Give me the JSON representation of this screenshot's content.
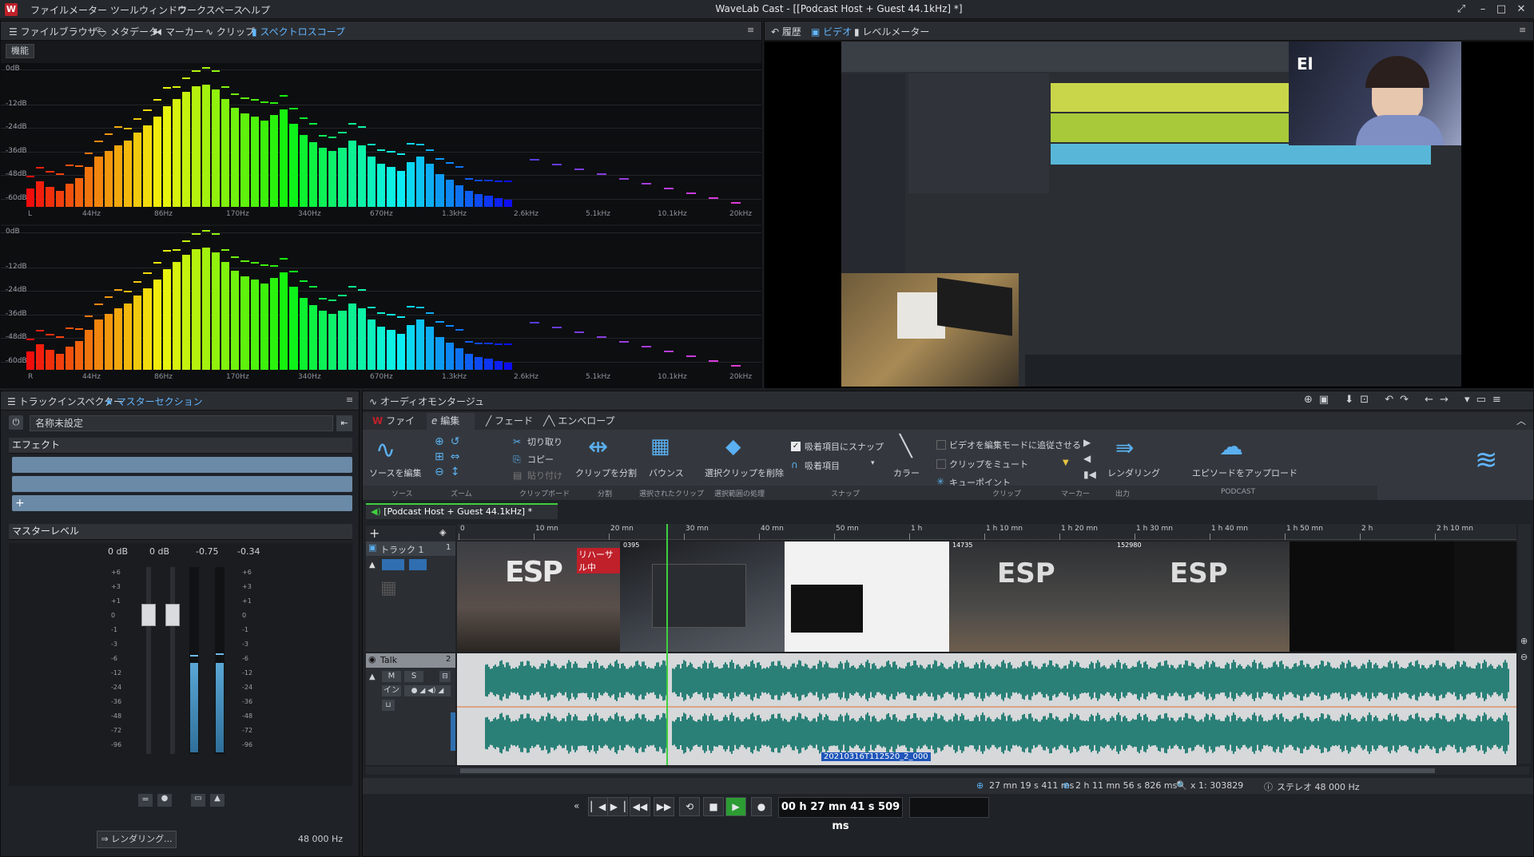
{
  "app": {
    "title": "WaveLab Cast - [[Podcast Host + Guest 44.1kHz] *]",
    "logo": "W",
    "menu": [
      "ファイル",
      "メーター",
      "ツールウィンドウ",
      "ワークスペース",
      "ヘルプ"
    ],
    "accent_color": "#62b6ff"
  },
  "left_top_panel": {
    "tabs": [
      "ファイルブラウザー",
      "メタデータ",
      "マーカー",
      "クリップ",
      "スペクトロスコープ"
    ],
    "active_tab": "スペクトロスコープ",
    "function_button": "機能",
    "db_labels": [
      "0dB",
      "-12dB",
      "-24dB",
      "-36dB",
      "-48dB",
      "-60dB"
    ],
    "freq_labels": [
      "44Hz",
      "86Hz",
      "170Hz",
      "340Hz",
      "670Hz",
      "1.3kHz",
      "2.6kHz",
      "5.1kHz",
      "10.1kHz",
      "20kHz"
    ],
    "channel_left": "L",
    "channel_right": "R"
  },
  "right_top_panel": {
    "tabs": [
      "履歴",
      "ビデオ",
      "レベルメーター"
    ],
    "active_tab": "ビデオ"
  },
  "inspector": {
    "tabs": [
      "トラックインスペクター",
      "マスターセクション"
    ],
    "active_tab": "マスターセクション",
    "preset_name": "名称未設定",
    "effects_label": "エフェクト",
    "add_label": "+",
    "master_level_label": "マスターレベル",
    "level_values": [
      "0 dB",
      "0 dB",
      "-0.75",
      "-0.34"
    ],
    "scale": [
      "+6",
      "+3",
      "+1",
      "0",
      "-1",
      "-3",
      "-6",
      "-12",
      "-24",
      "-36",
      "-48",
      "-72",
      "-96"
    ],
    "render_button": "レンダリング...",
    "sample_rate": "48 000 Hz"
  },
  "montage": {
    "title": "オーディオモンタージュ",
    "ribbon_tabs": [
      "ファイル",
      "編集",
      "フェード",
      "エンベロープ"
    ],
    "active_ribbon_tab": "編集",
    "tools": {
      "source_edit": "ソースを編集",
      "cut": "切り取り",
      "copy": "コピー",
      "paste": "貼り付け",
      "split": "クリップを分割",
      "bounce": "バウンス",
      "delete_range": "選択クリップを削除",
      "snap_to": "吸着項目にスナップ",
      "snap_items": "吸着項目",
      "color": "カラー",
      "video_follow": "ビデオを編集モードに追従させる",
      "mute_clip": "クリップをミュート",
      "cue_point": "キューポイント",
      "render": "レンダリング",
      "upload": "エピソードをアップロード"
    },
    "groups": [
      "ソース",
      "ズーム",
      "クリップボード",
      "分割",
      "選択されたクリップ",
      "選択範囲の処理",
      "スナップ",
      "クリップ",
      "マーカー",
      "出力",
      "PODCAST"
    ],
    "doc_tab": "[Podcast Host + Guest 44.1kHz] *",
    "ruler": [
      "0",
      "10 mn",
      "20 mn",
      "30 mn",
      "40 mn",
      "50 mn",
      "1 h",
      "1 h 10 mn",
      "1 h 20 mn",
      "1 h 30 mn",
      "1 h 40 mn",
      "1 h 50 mn",
      "2 h",
      "2 h 10 mn"
    ],
    "track1_name": "トラック 1",
    "track1_num": "1",
    "track2_name": "Talk",
    "track2_num": "2",
    "mute": "M",
    "solo": "S",
    "input": "イン",
    "clip_label": "20210316T112520_2_000",
    "video_caption": "リハーサル中",
    "frame_numbers": [
      "0395",
      "14735",
      "152980"
    ],
    "status": {
      "cursor": "27 mn 19 s 411 ms",
      "length": "2 h 11 mn 56 s 826 ms",
      "zoom": "x 1: 303829",
      "format": "ステレオ 48 000 Hz"
    }
  },
  "transport": {
    "time": "00 h 27 mn 41 s 509 ms"
  },
  "spectrum_data": {
    "bars": [
      10,
      14,
      11,
      9,
      13,
      16,
      22,
      28,
      31,
      34,
      37,
      41,
      45,
      50,
      56,
      60,
      64,
      67,
      68,
      65,
      60,
      55,
      52,
      50,
      48,
      51,
      54,
      46,
      40,
      36,
      33,
      31,
      33,
      37,
      34,
      28,
      24,
      22,
      20,
      25,
      28,
      24,
      18,
      15,
      12,
      9,
      7,
      6,
      5,
      4
    ]
  }
}
